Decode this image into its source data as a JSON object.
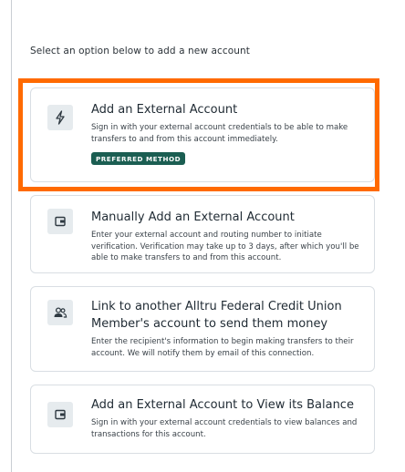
{
  "intro_text": "Select an option below to add a new account",
  "options": [
    {
      "icon": "lightning-icon",
      "title": "Add an External Account",
      "description": "Sign in with your external account credentials to be able to make transfers to and from this account immediately.",
      "badge": "PREFERRED METHOD",
      "highlighted": true
    },
    {
      "icon": "wallet-icon",
      "title": "Manually Add an External Account",
      "description": "Enter your external account and routing number to initiate verification. Verification may take up to 3 days, after which you'll be able to make transfers to and from this account."
    },
    {
      "icon": "people-icon",
      "title": "Link to another Alltru Federal Credit Union Member's account to send them money",
      "description": "Enter the recipient's information to begin making transfers to their account. We will notify them by email of this connection."
    },
    {
      "icon": "wallet-icon",
      "title": "Add an External Account to View its Balance",
      "description": "Sign in with your external account credentials to view balances and transactions for this account."
    }
  ],
  "colors": {
    "highlight_border": "#ff6a00",
    "badge_background": "#1b5e52",
    "icon_background": "#e6ebee",
    "card_border": "#d9dee3"
  }
}
